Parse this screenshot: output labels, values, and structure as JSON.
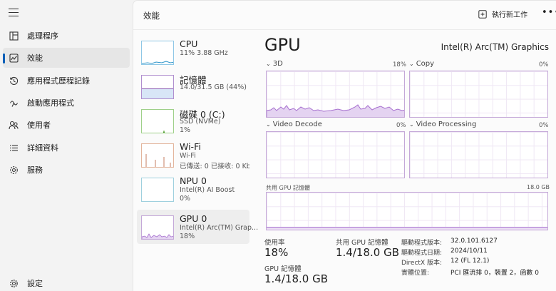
{
  "nav": {
    "items": [
      {
        "label": "處理程序",
        "icon": "processes-icon"
      },
      {
        "label": "效能",
        "icon": "performance-icon"
      },
      {
        "label": "應用程式歷程記錄",
        "icon": "history-icon"
      },
      {
        "label": "啟動應用程式",
        "icon": "startup-icon"
      },
      {
        "label": "使用者",
        "icon": "users-icon"
      },
      {
        "label": "詳細資料",
        "icon": "details-icon"
      },
      {
        "label": "服務",
        "icon": "services-icon"
      }
    ],
    "settings_label": "設定"
  },
  "header": {
    "title": "效能",
    "run_task_label": "執行新工作",
    "more_label": "•••"
  },
  "resources": [
    {
      "title": "CPU",
      "sub1": "11%  3.88 GHz",
      "sub2": ""
    },
    {
      "title": "記憶體",
      "sub1": "14.0/31.5 GB (44%)",
      "sub2": ""
    },
    {
      "title": "磁碟 0 (C:)",
      "sub1": "SSD (NVMe)",
      "sub2": "1%"
    },
    {
      "title": "Wi-Fi",
      "sub1": "Wi-Fi",
      "sub2": "已傳送: 0  已接收: 0 Kbps"
    },
    {
      "title": "NPU 0",
      "sub1": "Intel(R) AI Boost",
      "sub2": "0%"
    },
    {
      "title": "GPU 0",
      "sub1": "Intel(R) Arc(TM) Grap...",
      "sub2": "18%"
    }
  ],
  "detail": {
    "title": "GPU",
    "model": "Intel(R) Arc(TM) Graphics",
    "engines": [
      {
        "name": "3D",
        "pct": "18%"
      },
      {
        "name": "Copy",
        "pct": "0%"
      },
      {
        "name": "Video Decode",
        "pct": "0%"
      },
      {
        "name": "Video Processing",
        "pct": "0%"
      }
    ],
    "shared_mem_label": "共用 GPU 記憶體",
    "shared_mem_max": "18.0 GB",
    "shared_mem_fraction": 0.078,
    "stats": {
      "util_label": "使用率",
      "util_value": "18%",
      "shared_label": "共用 GPU 記憶體",
      "shared_value": "1.4/18.0 GB",
      "gpumem_label": "GPU 記憶體",
      "gpumem_value": "1.4/18.0 GB"
    },
    "info": [
      {
        "label": "驅動程式版本:",
        "value": "32.0.101.6127"
      },
      {
        "label": "驅動程式日期:",
        "value": "2024/10/11"
      },
      {
        "label": "DirectX 版本:",
        "value": "12 (FL 12.1)"
      },
      {
        "label": "實體位置:",
        "value": "PCI 匯流排 0，裝置 2，函數 0"
      }
    ]
  },
  "colors": {
    "accent": "#005fb8",
    "gpu_line": "#a66fcf",
    "gpu_fill": "#e4d3f1",
    "cpu_line": "#2b94c9",
    "mem_line": "#8d5cb3",
    "disk_line": "#4c9a2a",
    "wifi_line": "#b85e3a",
    "npu_line": "#2f8fa8"
  }
}
